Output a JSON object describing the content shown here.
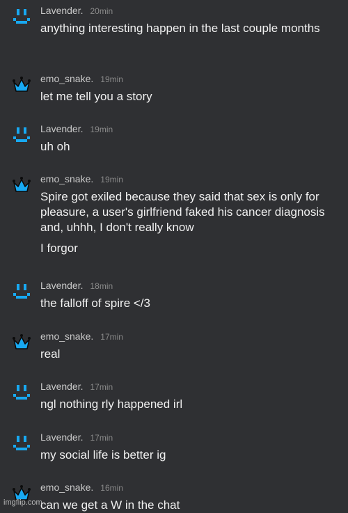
{
  "colors": {
    "background": "#2f3033",
    "avatar_blue": "#18a9f2",
    "text": "#f0f0f0",
    "username": "#c9c9c9",
    "time": "#8a8a8a"
  },
  "messages": [
    {
      "avatar": "smiley-face-icon",
      "username": "Lavender.",
      "time": "20min",
      "lines": [
        "anything interesting happen in the last couple months"
      ]
    },
    {
      "avatar": "crown-icon",
      "username": "emo_snake.",
      "time": "19min",
      "lines": [
        "let me tell you a story"
      ]
    },
    {
      "avatar": "smiley-face-icon",
      "username": "Lavender.",
      "time": "19min",
      "lines": [
        "uh oh"
      ]
    },
    {
      "avatar": "crown-icon",
      "username": "emo_snake.",
      "time": "19min",
      "lines": [
        "Spire got exiled because they said that sex is only for pleasure, a user's girlfriend faked his cancer diagnosis and, uhhh, I don't really know",
        "I forgor"
      ]
    },
    {
      "avatar": "smiley-face-icon",
      "username": "Lavender.",
      "time": "18min",
      "lines": [
        "the falloff of spire </3"
      ]
    },
    {
      "avatar": "crown-icon",
      "username": "emo_snake.",
      "time": "17min",
      "lines": [
        "real"
      ]
    },
    {
      "avatar": "smiley-face-icon",
      "username": "Lavender.",
      "time": "17min",
      "lines": [
        "ngl nothing rly happened irl"
      ]
    },
    {
      "avatar": "smiley-face-icon",
      "username": "Lavender.",
      "time": "17min",
      "lines": [
        "my social life is better ig"
      ]
    },
    {
      "avatar": "crown-icon",
      "username": "emo_snake.",
      "time": "16min",
      "lines": [
        "can we get a W in the chat"
      ]
    }
  ],
  "watermark": "imgflip.com"
}
